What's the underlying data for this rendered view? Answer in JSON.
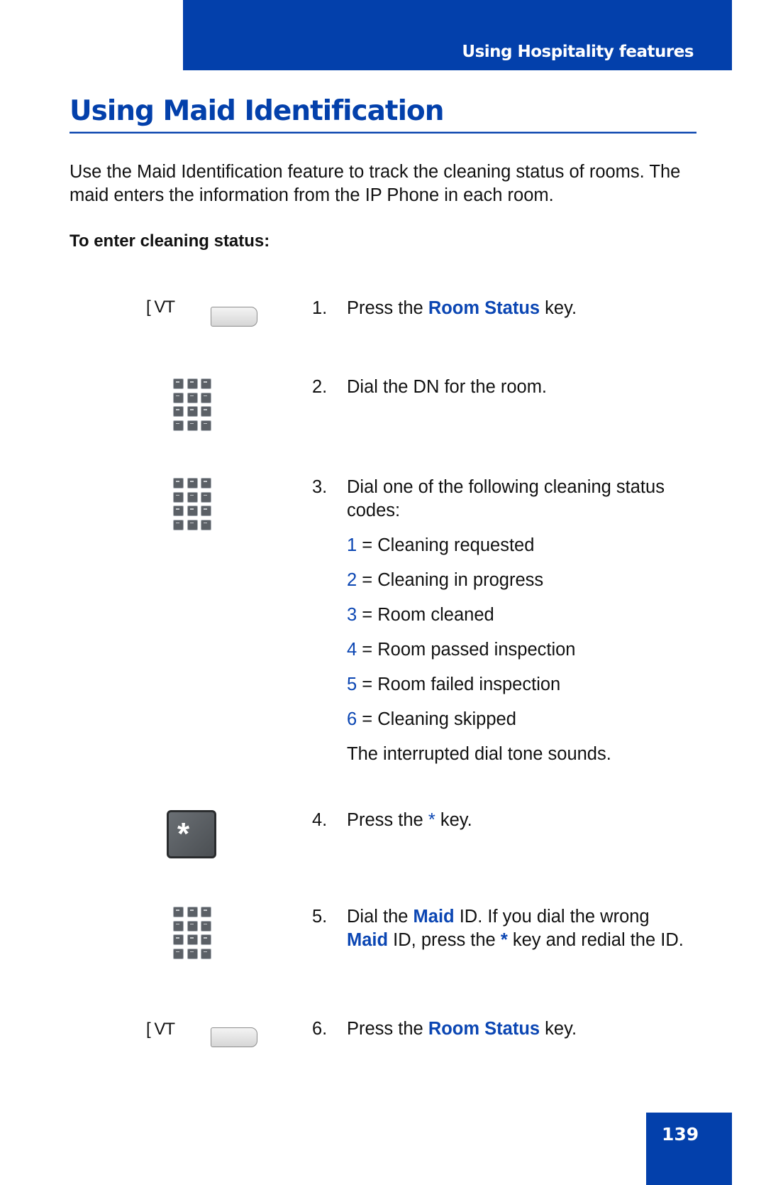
{
  "header": {
    "section_title": "Using Hospitality features"
  },
  "page": {
    "title": "Using Maid Identification",
    "intro": "Use the Maid Identification feature to track the cleaning status of rooms. The maid enters the information from the IP Phone in each room.",
    "procedure_heading": "To enter cleaning status:",
    "page_number": "139"
  },
  "icons": {
    "softkey_label": "[ VT",
    "star_key_glyph": "*"
  },
  "steps": [
    {
      "num": "1.",
      "pre": "Press the ",
      "key": "Room Status",
      "post": " key."
    },
    {
      "num": "2.",
      "text": "Dial the DN for the room."
    },
    {
      "num": "3.",
      "text": "Dial one of the following cleaning status codes:"
    },
    {
      "num": "4.",
      "pre": "Press the ",
      "key": "*",
      "post": " key."
    },
    {
      "num": "5.",
      "pre": "Dial the ",
      "key": "Maid",
      "mid": " ID. If you dial the wrong ",
      "key2": "Maid",
      "mid2": " ID, press the ",
      "key3": "*",
      "post": " key and redial the ID."
    },
    {
      "num": "6.",
      "pre": "Press the ",
      "key": "Room Status",
      "post": " key."
    }
  ],
  "status_codes": [
    {
      "code": "1",
      "eq": " = ",
      "label": "Cleaning requested"
    },
    {
      "code": "2",
      "eq": " = ",
      "label": "Cleaning in progress"
    },
    {
      "code": "3",
      "eq": " = ",
      "label": "Room cleaned"
    },
    {
      "code": "4",
      "eq": " = ",
      "label": "Room passed inspection"
    },
    {
      "code": "5",
      "eq": " = ",
      "label": "Room failed inspection"
    },
    {
      "code": "6",
      "eq": " = ",
      "label": "Cleaning skipped"
    }
  ],
  "tone_note": "The interrupted dial tone sounds.",
  "colors": {
    "brand_blue": "#0340ab",
    "link_blue": "#0b46b3"
  }
}
